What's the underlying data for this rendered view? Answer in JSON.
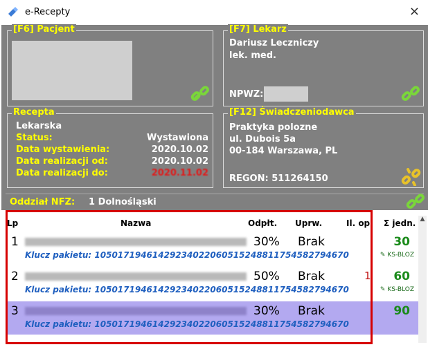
{
  "window": {
    "title": "e-Recepty",
    "close": "×"
  },
  "pacjent": {
    "legend": "[F6] Pacjent"
  },
  "lekarz": {
    "legend": "[F7] Lekarz",
    "name": "Dariusz Leczniczy",
    "title": "lek. med.",
    "npwz_label": "NPWZ:"
  },
  "recepta": {
    "legend": "Recepta",
    "type": "Lekarska",
    "status_label": "Status:",
    "status_value": "Wystawiona",
    "date_issue_label": "Data wystawienia:",
    "date_issue_value": "2020.10.02",
    "date_from_label": "Data realizacji od:",
    "date_from_value": "2020.10.02",
    "date_to_label": "Data realizacji do:",
    "date_to_value": "2020.11.02"
  },
  "swiadczeniodawca": {
    "legend": "[F12] Świadczeniodawca",
    "name": "Praktyka polozne",
    "street": "ul. Dubois 5a",
    "city": "00-184 Warszawa, PL",
    "regon": "REGON: 511264150"
  },
  "nfz": {
    "label": "Oddział NFZ:",
    "value": "1 Dolnośląski"
  },
  "table": {
    "headers": {
      "lp": "Lp",
      "nazwa": "Nazwa",
      "odplt": "Odpłt.",
      "uprw": "Uprw.",
      "ilop": "Il. op.",
      "sum": "Σ jedn."
    },
    "rows": [
      {
        "lp": "1",
        "pct": "30%",
        "uprw": "Brak",
        "qty": "",
        "sum": "30",
        "key": "Klucz pakietu: 10501719461429234022060515248811754582794670",
        "ks": "KS-BLOZ"
      },
      {
        "lp": "2",
        "pct": "50%",
        "uprw": "Brak",
        "qty": "1",
        "sum": "60",
        "key": "Klucz pakietu: 10501719461429234022060515248811754582794670",
        "ks": "KS-BLOZ"
      },
      {
        "lp": "3",
        "pct": "30%",
        "uprw": "Brak",
        "qty": "",
        "sum": "90",
        "key": "Klucz pakietu: 10501719461429234022060515248811754582794670",
        "ks": ""
      }
    ]
  },
  "icons": {
    "app": "pill-icon",
    "link": "link-icon",
    "broken_link": "broken-link-icon",
    "ks": "pencil-icon"
  }
}
